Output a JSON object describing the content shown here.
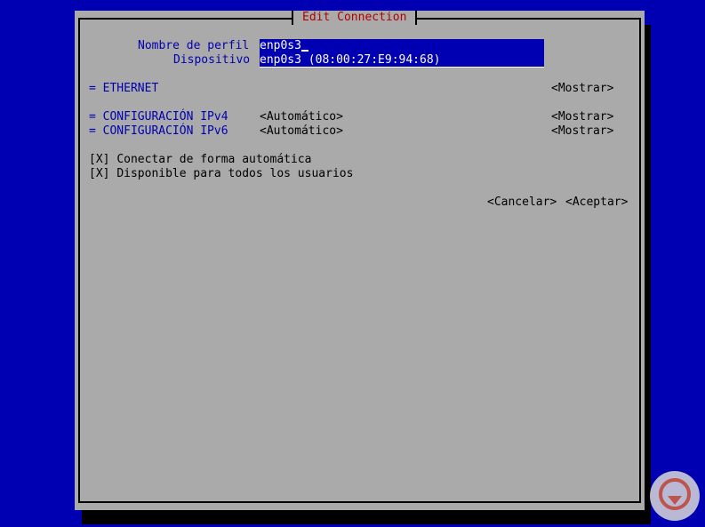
{
  "window": {
    "title": "Edit Connection"
  },
  "profile": {
    "name_label": "Nombre de perfil",
    "name_value": "enp0s3",
    "device_label": "Dispositivo",
    "device_value": "enp0s3 (08:00:27:E9:94:68)"
  },
  "sections": {
    "ethernet": {
      "label": "= ETHERNET",
      "show": "<Mostrar>"
    },
    "ipv4": {
      "label": "= CONFIGURACIÓN IPv4",
      "mode": "<Automático>",
      "show": "<Mostrar>"
    },
    "ipv6": {
      "label": "= CONFIGURACIÓN IPv6",
      "mode": "<Automático>",
      "show": "<Mostrar>"
    }
  },
  "options": {
    "autoconnect": {
      "box": "[X]",
      "label": "Conectar de forma automática"
    },
    "all_users": {
      "box": "[X]",
      "label": "Disponible para todos los usuarios"
    }
  },
  "actions": {
    "cancel": "<Cancelar>",
    "accept": "<Aceptar>"
  },
  "colors": {
    "background": "#0000b2",
    "window": "#aaaaaa",
    "title": "#b20000",
    "field_bg": "#0000b2",
    "field_text": "#ffffff"
  },
  "icons": {
    "watermark": "solvetic-logo"
  }
}
